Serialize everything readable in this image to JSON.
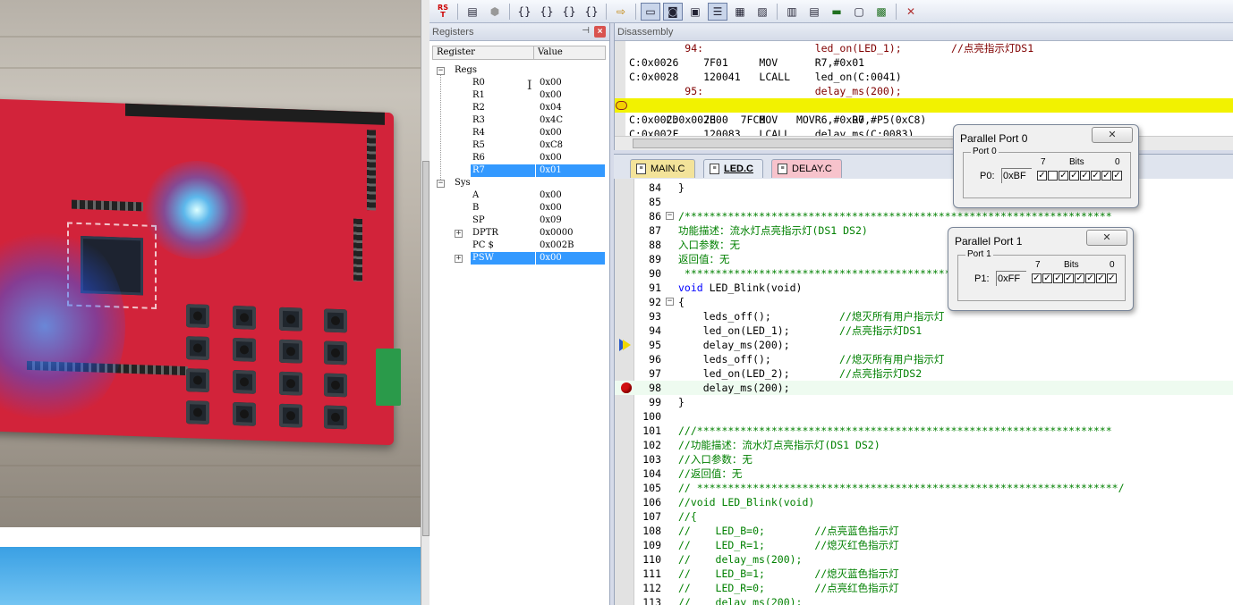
{
  "toolbar": {
    "rst_label_1": "RS",
    "rst_label_2": "T",
    "buttons": [
      "{}",
      "{}",
      "{}",
      "{}",
      "⇨"
    ]
  },
  "registers": {
    "title": "Registers",
    "col_register": "Register",
    "col_value": "Value",
    "regs_group": "Regs",
    "regs": [
      {
        "name": "R0",
        "value": "0x00"
      },
      {
        "name": "R1",
        "value": "0x00"
      },
      {
        "name": "R2",
        "value": "0x04"
      },
      {
        "name": "R3",
        "value": "0x4C"
      },
      {
        "name": "R4",
        "value": "0x00"
      },
      {
        "name": "R5",
        "value": "0xC8"
      },
      {
        "name": "R6",
        "value": "0x00"
      },
      {
        "name": "R7",
        "value": "0x01"
      }
    ],
    "sys_group": "Sys",
    "sys": [
      {
        "name": "A",
        "value": "0x00"
      },
      {
        "name": "B",
        "value": "0x00"
      },
      {
        "name": "SP",
        "value": "0x09"
      },
      {
        "name": "DPTR",
        "value": "0x0000"
      },
      {
        "name": "PC $",
        "value": "0x002B"
      },
      {
        "name": "PSW",
        "value": "0x00"
      }
    ]
  },
  "disassembly": {
    "title": "Disassembly",
    "lines": [
      "         94:                  led_on(LED_1);        //点亮指示灯DS1",
      "C:0x0026    7F01     MOV      R7,#0x01",
      "C:0x0028    120041   LCALL    led_on(C:0041)",
      "         95:                  delay_ms(200);",
      "C:0x002B    7FC8     MOV      R7,#P5(0xC8)",
      "C:0x002D    7E00     MOV      R6,#0x00",
      "C:0x002F    120083   LCALL    delay_ms(C:0083)"
    ]
  },
  "tabs": [
    "MAIN.C",
    "LED.C",
    "DELAY.C"
  ],
  "editor": {
    "lines": [
      {
        "n": "84",
        "text": "}"
      },
      {
        "n": "85",
        "text": ""
      },
      {
        "n": "86",
        "text": "/*********************************************************************"
      },
      {
        "n": "87",
        "text": "功能描述：流水灯点亮指示灯(DS1 DS2)"
      },
      {
        "n": "88",
        "text": "入口参数：无"
      },
      {
        "n": "89",
        "text": "返回值：无"
      },
      {
        "n": "90",
        "text": " *********************************************************************/"
      },
      {
        "n": "91",
        "text": "void LED_Blink(void)"
      },
      {
        "n": "92",
        "text": "{"
      },
      {
        "n": "93",
        "text": "    leds_off();           //熄灭所有用户指示灯"
      },
      {
        "n": "94",
        "text": "    led_on(LED_1);        //点亮指示灯DS1"
      },
      {
        "n": "95",
        "text": "    delay_ms(200);"
      },
      {
        "n": "96",
        "text": "    leds_off();           //熄灭所有用户指示灯"
      },
      {
        "n": "97",
        "text": "    led_on(LED_2);        //点亮指示灯DS2"
      },
      {
        "n": "98",
        "text": "    delay_ms(200);"
      },
      {
        "n": "99",
        "text": "}"
      },
      {
        "n": "100",
        "text": ""
      },
      {
        "n": "101",
        "text": "///*******************************************************************"
      },
      {
        "n": "102",
        "text": "//功能描述：流水灯点亮指示灯(DS1 DS2)"
      },
      {
        "n": "103",
        "text": "//入口参数：无"
      },
      {
        "n": "104",
        "text": "//返回值：无"
      },
      {
        "n": "105",
        "text": "// ********************************************************************/"
      },
      {
        "n": "106",
        "text": "//void LED_Blink(void)"
      },
      {
        "n": "107",
        "text": "//{"
      },
      {
        "n": "108",
        "text": "//    LED_B=0;        //点亮蓝色指示灯"
      },
      {
        "n": "109",
        "text": "//    LED_R=1;        //熄灭红色指示灯"
      },
      {
        "n": "110",
        "text": "//    delay_ms(200);"
      },
      {
        "n": "111",
        "text": "//    LED_B=1;        //熄灭蓝色指示灯"
      },
      {
        "n": "112",
        "text": "//    LED_R=0;        //点亮红色指示灯"
      },
      {
        "n": "113",
        "text": "//    delay_ms(200);"
      }
    ]
  },
  "port0": {
    "title": "Parallel Port 0",
    "group": "Port 0",
    "label": "P0:",
    "value": "0xBF",
    "bits_label": "Bits",
    "bit_hi": "7",
    "bit_lo": "0",
    "bits": [
      true,
      false,
      true,
      true,
      true,
      true,
      true,
      true
    ]
  },
  "port1": {
    "title": "Parallel Port 1",
    "group": "Port 1",
    "label": "P1:",
    "value": "0xFF",
    "bits_label": "Bits",
    "bit_hi": "7",
    "bit_lo": "0",
    "bits": [
      true,
      true,
      true,
      true,
      true,
      true,
      true,
      true
    ]
  }
}
